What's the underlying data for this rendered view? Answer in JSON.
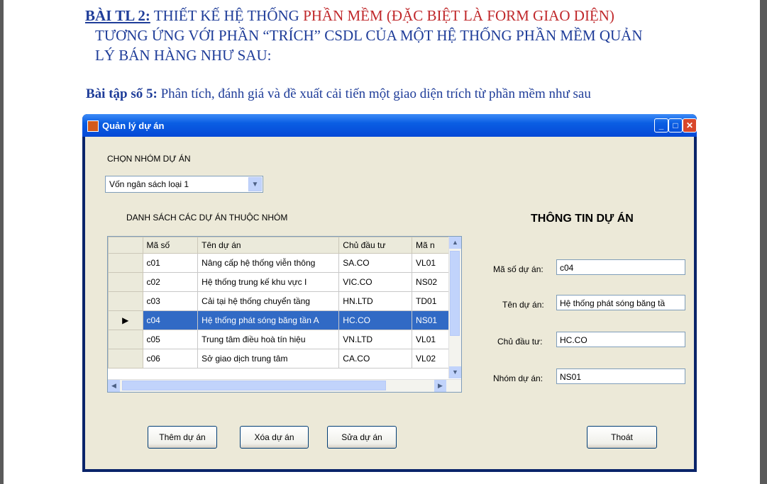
{
  "document": {
    "heading_label": "BÀI TL 2:",
    "heading_part1": "THIẾT KẾ HỆ THỐNG ",
    "heading_red": "PHẦN MỀM (ĐẶC BIỆT LÀ FORM GIAO DIỆN)",
    "heading_line2": "TƯƠNG ỨNG VỚI PHẦN “TRÍCH” CSDL CỦA MỘT HỆ THỐNG PHẦN MỀM QUẢN",
    "heading_line3": "LÝ BÁN HÀNG NHƯ SAU:",
    "exercise_label": "Bài tập số 5:",
    "exercise_text": " Phân tích, đánh giá và đề xuất cải tiến một giao diện trích từ phần mềm như sau"
  },
  "window": {
    "title": "Quản lý dự án",
    "group_label": "CHỌN NHÓM DỰ ÁN",
    "group_value": "Vốn ngân sách loại 1",
    "list_label": "DANH SÁCH CÁC DỰ ÁN THUỘC NHÓM",
    "info_title": "THÔNG TIN DỰ ÁN",
    "columns": [
      "Mã số",
      "Tên dự án",
      "Chủ đầu tư",
      "Mã n"
    ],
    "rows": [
      [
        "c01",
        "Nâng cấp hệ thống viễn thông",
        "SA.CO",
        "VL01"
      ],
      [
        "c02",
        "Hệ thống trung kế khu vực I",
        "VIC.CO",
        "NS02"
      ],
      [
        "c03",
        "Cải tại hệ thống chuyển tầng",
        "HN.LTD",
        "TD01"
      ],
      [
        "c04",
        "Hệ thống phát sóng băng tần A",
        "HC.CO",
        "NS01"
      ],
      [
        "c05",
        "Trung tâm điều hoà tín hiệu",
        "VN.LTD",
        "VL01"
      ],
      [
        "c06",
        "Sở giao dịch trung tâm",
        "CA.CO",
        "VL02"
      ]
    ],
    "selected_row": 3,
    "fields": {
      "ma_so_label": "Mã số dự án:",
      "ma_so_value": "c04",
      "ten_label": "Tên dự án:",
      "ten_value": "Hệ thống phát sóng băng tầ",
      "chu_label": "Chủ đầu tư:",
      "chu_value": "HC.CO",
      "nhom_label": "Nhóm dự án:",
      "nhom_value": "NS01"
    },
    "buttons": {
      "add": "Thêm dự án",
      "delete": "Xóa dự án",
      "edit": "Sửa dự án",
      "exit": "Thoát"
    }
  }
}
